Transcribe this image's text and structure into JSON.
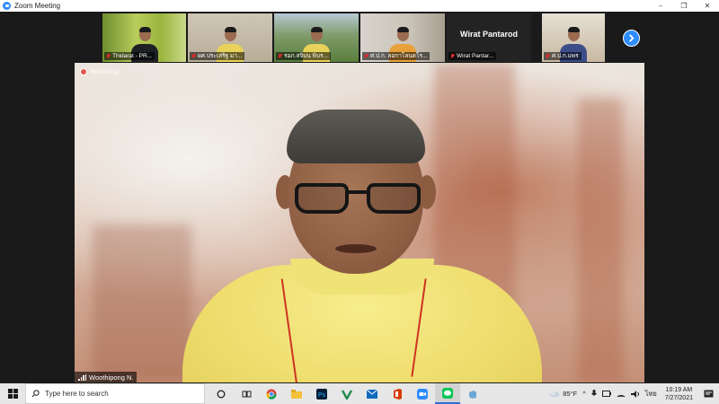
{
  "window": {
    "title": "Zoom Meeting",
    "controls": [
      "minimize-icon",
      "restore-icon",
      "close-icon"
    ]
  },
  "gallery": {
    "tiles": [
      {
        "name": "Thidarat - PR...",
        "muted": true,
        "kind": "video"
      },
      {
        "name": "ผศ.ประเสริฐ มา...",
        "muted": true,
        "kind": "video"
      },
      {
        "name": "รอภ.สจิบน พิบร...",
        "muted": true,
        "kind": "video"
      },
      {
        "name": "ศ.ป.ก. ลอกาโลนดโร...",
        "muted": true,
        "kind": "video"
      },
      {
        "name": "Wirat Pantar...",
        "muted": true,
        "kind": "namecard",
        "display_name": "Wirat Pantarod"
      },
      {
        "name": "ศ.ป.ก.แพร",
        "muted": true,
        "kind": "video"
      }
    ],
    "next_page_icon": "chevron-right-icon"
  },
  "speaker": {
    "recording_label": "Recording",
    "name": "Woothipong N."
  },
  "taskbar": {
    "search_placeholder": "Type here to search",
    "apps": [
      "task-view-icon",
      "chrome-icon",
      "file-explorer-icon",
      "photoshop-icon",
      "vim-icon",
      "mail-icon",
      "office-icon",
      "zoom-icon",
      "line-icon",
      "app-icon"
    ],
    "weather": "85°F",
    "language": "ไทย",
    "time": "10:19 AM",
    "date": "7/27/2021"
  },
  "colors": {
    "zoom_blue": "#2d8cff",
    "muted_red": "#e02828",
    "shirt_yellow": "#eedc6c"
  }
}
